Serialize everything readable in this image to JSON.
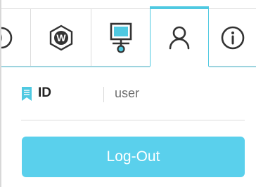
{
  "tabs": [
    {
      "icon": "power-icon",
      "active": false
    },
    {
      "icon": "w-hexagon-icon",
      "label": "W",
      "active": false
    },
    {
      "icon": "network-monitor-icon",
      "active": false
    },
    {
      "icon": "user-icon",
      "active": true
    },
    {
      "icon": "info-icon",
      "active": false
    }
  ],
  "user_panel": {
    "id_icon": "bookmark-icon",
    "id_label": "ID",
    "id_value": "user",
    "logout_label": "Log-Out"
  },
  "colors": {
    "accent": "#4fc9e1",
    "button": "#5ad0ec",
    "button_text": "#ffffff",
    "icon_dark": "#333333"
  }
}
